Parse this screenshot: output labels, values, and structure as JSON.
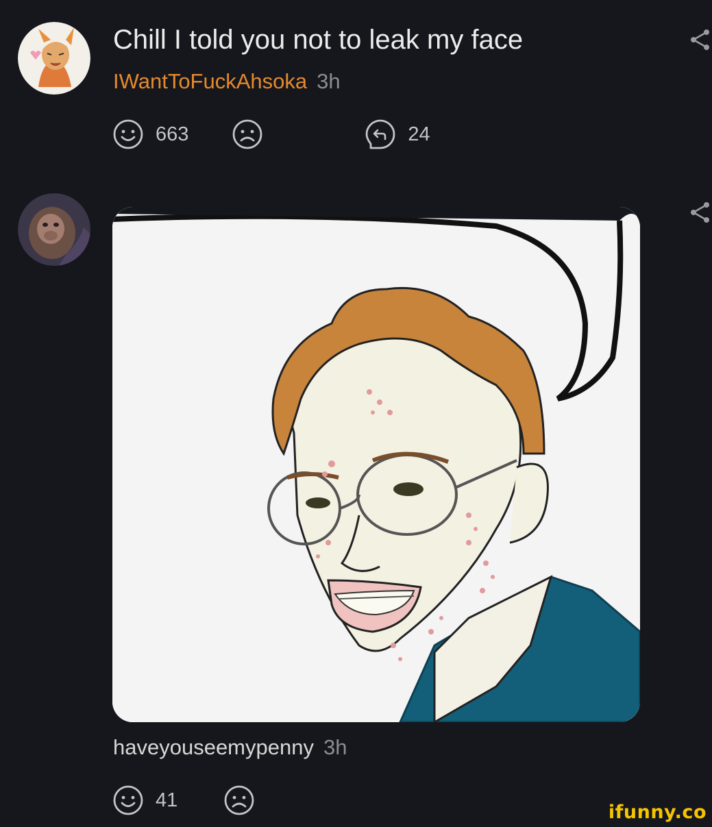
{
  "comments": [
    {
      "text": "Chill I told you not to leak my face",
      "username": "IWantToFuckAhsoka",
      "time": "3h",
      "smile_count": "663",
      "reply_count": "24",
      "username_color": "#e58a2e"
    },
    {
      "username": "haveyouseemypenny",
      "time": "3h",
      "smile_count": "41"
    }
  ],
  "icons": {
    "smile": "smile-icon",
    "frown": "frown-icon",
    "reply": "reply-icon",
    "share": "share-icon"
  },
  "watermark": "ifunny.co",
  "colors": {
    "background": "#16171c",
    "watermark": "#f5c400"
  }
}
